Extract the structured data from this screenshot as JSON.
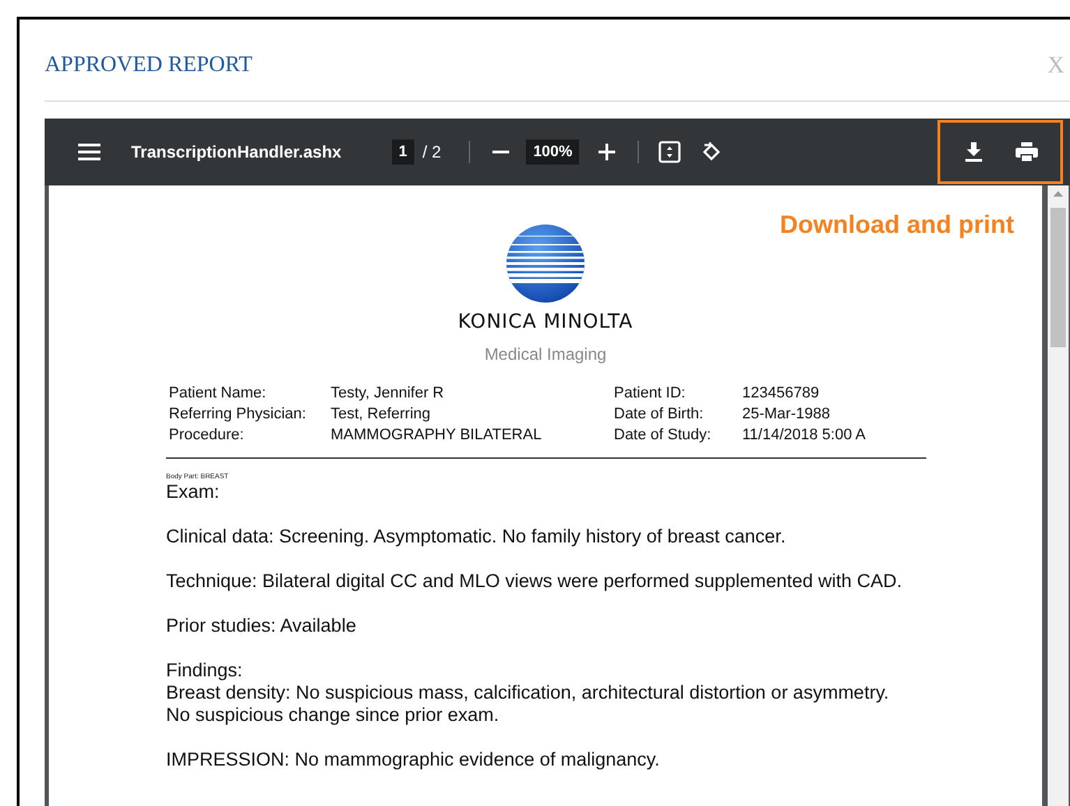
{
  "dialog": {
    "title": "APPROVED REPORT",
    "close": "X"
  },
  "viewer": {
    "file_name": "TranscriptionHandler.ashx",
    "page": "1",
    "page_total": "/ 2",
    "zoom": "100%"
  },
  "callout": {
    "text": "Download and print"
  },
  "report": {
    "company": "KONICA MINOLTA",
    "subtitle": "Medical Imaging",
    "fields_left": [
      {
        "label": "Patient Name:",
        "value": "Testy, Jennifer R"
      },
      {
        "label": "Referring Physician:",
        "value": "Test, Referring"
      },
      {
        "label": "Procedure:",
        "value": "MAMMOGRAPHY BILATERAL"
      }
    ],
    "fields_right": [
      {
        "label": "Patient ID:",
        "value": "123456789"
      },
      {
        "label": "Date of Birth:",
        "value": "25-Mar-1988"
      },
      {
        "label": "Date of Study:",
        "value": "11/14/2018 5:00 A"
      }
    ],
    "body_part": "Body Part: BREAST",
    "paragraphs": [
      [
        "Exam:"
      ],
      [
        "Clinical data: Screening. Asymptomatic. No family history of breast cancer."
      ],
      [
        "Technique: Bilateral digital CC and MLO views were performed supplemented with CAD."
      ],
      [
        "Prior studies: Available"
      ],
      [
        "Findings:",
        "Breast density: No suspicious mass, calcification, architectural distortion or asymmetry.",
        "No suspicious change since prior exam."
      ],
      [
        "IMPRESSION: No mammographic evidence of malignancy."
      ]
    ]
  }
}
